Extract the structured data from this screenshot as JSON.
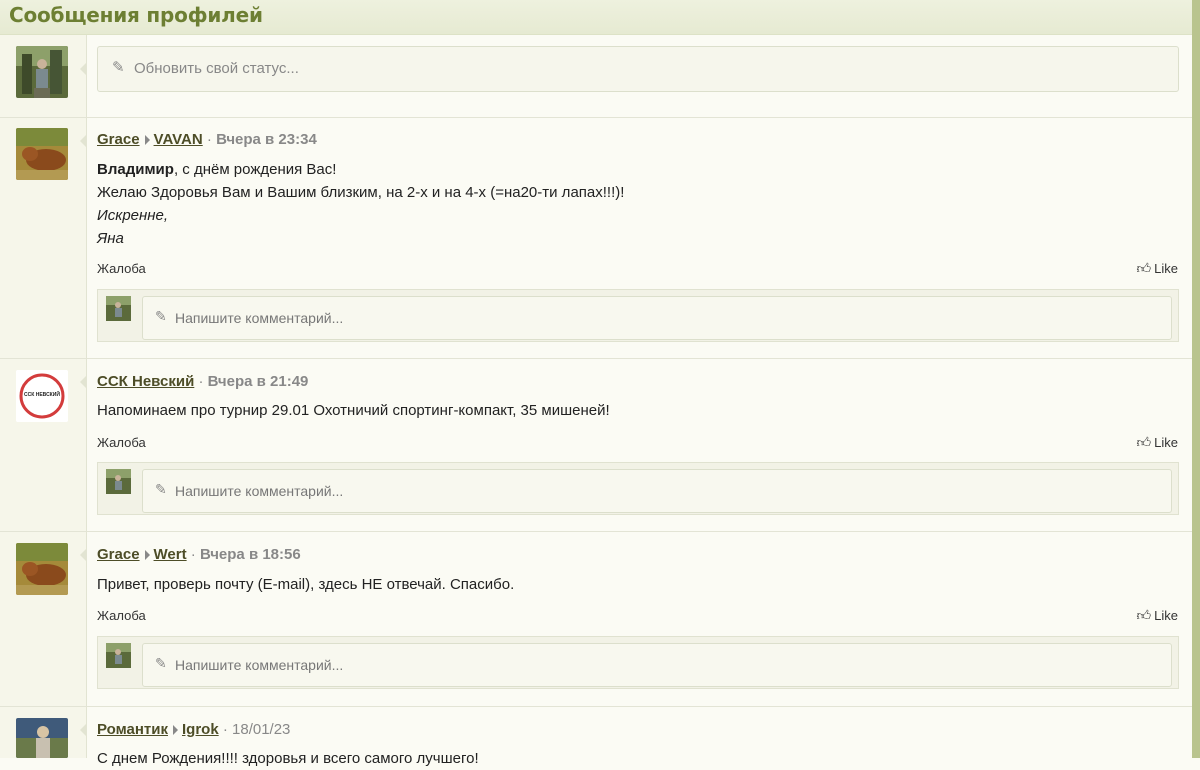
{
  "page": {
    "title": "Сообщения профилей"
  },
  "status": {
    "placeholder": "Обновить свой статус..."
  },
  "labels": {
    "report": "Жалоба",
    "like": "Like",
    "comment_placeholder": "Напишите комментарий..."
  },
  "messages": [
    {
      "author": "Grace",
      "recipient": "VAVAN",
      "time": "Вчера в 23:34",
      "body": {
        "greeting_name": "Владимир",
        "greeting_rest": ", с днём рождения Вас!",
        "line2": "Желаю Здоровья Вам и Вашим близким, на 2-х и на 4-х (=на20-ти лапах!!!)!",
        "line3": "Искренне,",
        "line4": "Яна"
      }
    },
    {
      "author": "ССК Невский",
      "time": "Вчера в 21:49",
      "body": {
        "text": "Напоминаем про турнир 29.01 Охотничий спортинг-компакт, 35 мишеней!"
      },
      "avatar_text": "ССК НЕВСКИЙ"
    },
    {
      "author": "Grace",
      "recipient": "Wert",
      "time": "Вчера в 18:56",
      "body": {
        "text": "Привет, проверь почту (E-mail), здесь НЕ отвечай. Спасибо."
      }
    },
    {
      "author": "Романтик",
      "recipient": "Igrok",
      "time": "18/01/23",
      "body": {
        "text": "С днем Рождения!!!! здоровья и всего самого лучшего!"
      }
    }
  ],
  "colors": {
    "header_text": "#6d7f33",
    "accent_bar": "#b9c48e",
    "link": "#4d4d27"
  }
}
